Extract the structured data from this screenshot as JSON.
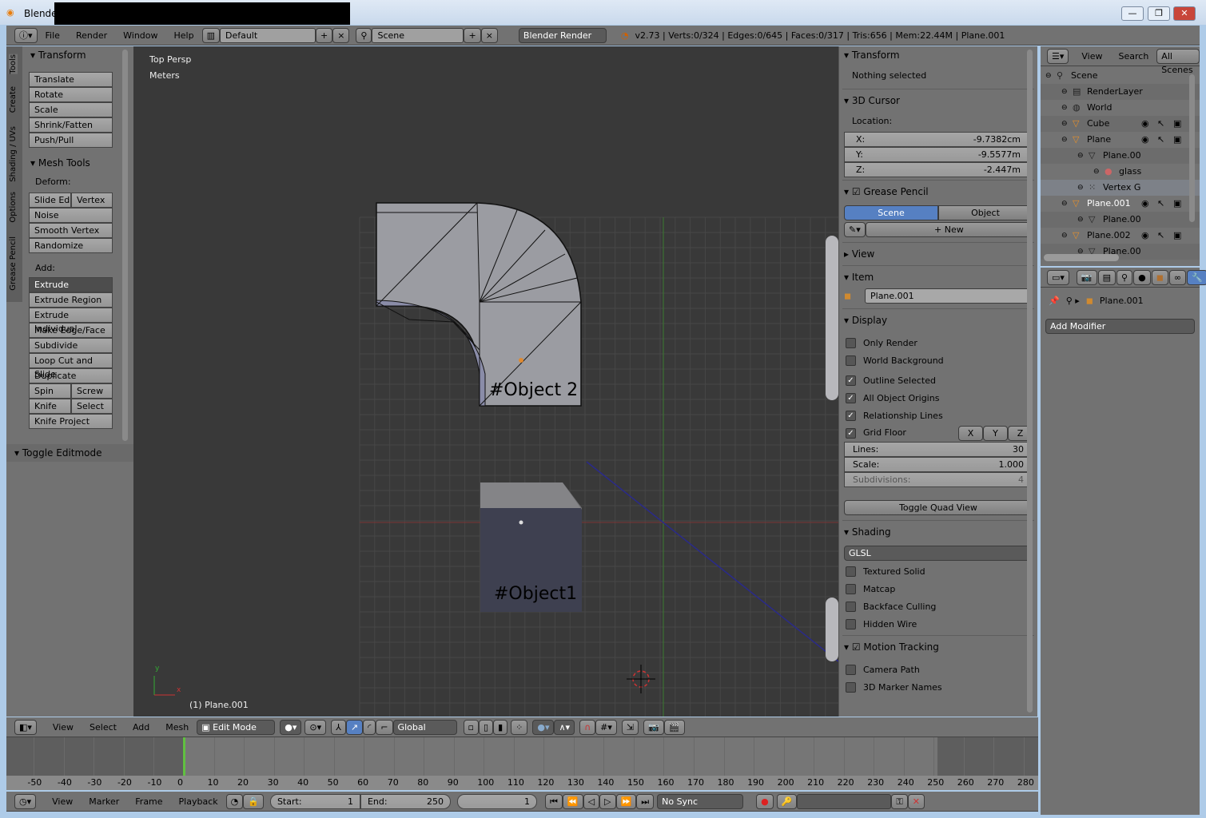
{
  "window": {
    "title": "Blender",
    "min": "—",
    "max": "❐",
    "close": "✕"
  },
  "info_header": {
    "menus": [
      "File",
      "Render",
      "Window",
      "Help"
    ],
    "screen_layout": "Default",
    "scene": "Scene",
    "engine": "Blender Render",
    "stats": "v2.73 | Verts:0/324 | Edges:0/645 | Faces:0/317 | Tris:656 | Mem:22.44M | Plane.001"
  },
  "toolshelf": {
    "tabs": [
      "Tools",
      "Create",
      "Shading / UVs",
      "Options",
      "Grease Pencil"
    ],
    "transform": {
      "title": "Transform",
      "buttons": [
        "Translate",
        "Rotate",
        "Scale",
        "Shrink/Fatten",
        "Push/Pull"
      ]
    },
    "mesh_tools": {
      "title": "Mesh Tools",
      "deform_label": "Deform:",
      "slide_edge": "Slide Ed",
      "vertex": "Vertex",
      "deform_buttons": [
        "Noise",
        "Smooth Vertex",
        "Randomize"
      ],
      "add_label": "Add:",
      "extrude": "Extrude",
      "add_buttons": [
        "Extrude Region",
        "Extrude Individual",
        "Make Edge/Face",
        "Subdivide",
        "Loop Cut and Slide",
        "Duplicate"
      ],
      "spin": "Spin",
      "screw": "Screw",
      "knife": "Knife",
      "select": "Select",
      "knife_project": "Knife Project"
    },
    "toggle_editmode": "Toggle Editmode"
  },
  "viewport": {
    "view_name": "Top Persp",
    "units": "Meters",
    "object_info": "(1) Plane.001",
    "label_object2": "#Object 2",
    "label_object1": "#Object1",
    "axis_x": "x",
    "axis_y": "y"
  },
  "npanel": {
    "transform": {
      "title": "Transform",
      "status": "Nothing selected"
    },
    "cursor": {
      "title": "3D Cursor",
      "location_label": "Location:",
      "x_label": "X:",
      "x": "-9.7382cm",
      "y_label": "Y:",
      "y": "-9.5577m",
      "z_label": "Z:",
      "z": "-2.447m"
    },
    "grease_pencil": {
      "title": "Grease Pencil",
      "scene": "Scene",
      "object": "Object",
      "new": "New"
    },
    "view": {
      "title": "View"
    },
    "item": {
      "title": "Item",
      "name": "Plane.001"
    },
    "display": {
      "title": "Display",
      "options": [
        {
          "label": "Only Render",
          "checked": false
        },
        {
          "label": "World Background",
          "checked": false
        },
        {
          "label": "Outline Selected",
          "checked": true
        },
        {
          "label": "All Object Origins",
          "checked": true
        },
        {
          "label": "Relationship Lines",
          "checked": true
        }
      ],
      "grid_floor": "Grid Floor",
      "x": "X",
      "y": "Y",
      "z": "Z",
      "lines_label": "Lines:",
      "lines": "30",
      "scale_label": "Scale:",
      "scale": "1.000",
      "subdiv_label": "Subdivisions:",
      "subdiv": "4",
      "toggle_quad": "Toggle Quad View"
    },
    "shading": {
      "title": "Shading",
      "mode": "GLSL",
      "options": [
        "Textured Solid",
        "Matcap",
        "Backface Culling",
        "Hidden Wire"
      ]
    },
    "motion_tracking": {
      "title": "Motion Tracking",
      "options": [
        "Camera Path",
        "3D Marker Names"
      ]
    }
  },
  "outliner": {
    "view": "View",
    "search": "Search",
    "filter": "All Scenes",
    "rows": [
      {
        "label": "Scene",
        "indent": 0,
        "icon": "scene-icon"
      },
      {
        "label": "RenderLayer",
        "indent": 1,
        "icon": "renderlayer-icon"
      },
      {
        "label": "World",
        "indent": 1,
        "icon": "world-icon"
      },
      {
        "label": "Cube",
        "indent": 1,
        "icon": "object-icon",
        "vis": true
      },
      {
        "label": "Plane",
        "indent": 1,
        "icon": "object-icon",
        "vis": true
      },
      {
        "label": "Plane.00",
        "indent": 2,
        "icon": "mesh-icon"
      },
      {
        "label": "glass",
        "indent": 3,
        "icon": "material-icon"
      },
      {
        "label": "Vertex G",
        "indent": 2,
        "icon": "vertex-group-icon"
      },
      {
        "label": "Plane.001",
        "indent": 1,
        "icon": "object-icon",
        "vis": true,
        "active": true
      },
      {
        "label": "Plane.00",
        "indent": 2,
        "icon": "mesh-icon"
      },
      {
        "label": "Plane.002",
        "indent": 1,
        "icon": "object-icon",
        "vis": true
      },
      {
        "label": "Plane.00",
        "indent": 2,
        "icon": "mesh-icon"
      }
    ]
  },
  "properties": {
    "object": "Plane.001",
    "add_modifier": "Add Modifier"
  },
  "view3d_header": {
    "menus": [
      "View",
      "Select",
      "Add",
      "Mesh"
    ],
    "mode": "Edit Mode",
    "orientation": "Global"
  },
  "timeline": {
    "ticks": [
      -50,
      -40,
      -30,
      -20,
      -10,
      0,
      10,
      20,
      30,
      40,
      50,
      60,
      70,
      80,
      90,
      100,
      110,
      120,
      130,
      140,
      150,
      160,
      170,
      180,
      190,
      200,
      210,
      220,
      230,
      240,
      250,
      260,
      270,
      280
    ],
    "current_frame": 1,
    "menus": [
      "View",
      "Marker",
      "Frame",
      "Playback"
    ],
    "start_label": "Start:",
    "start": "1",
    "end_label": "End:",
    "end": "250",
    "frame": "1",
    "sync": "No Sync"
  },
  "colors": {
    "accent": "#5680c2",
    "active_frame": "#60c040",
    "viewport_bg": "#393939"
  }
}
